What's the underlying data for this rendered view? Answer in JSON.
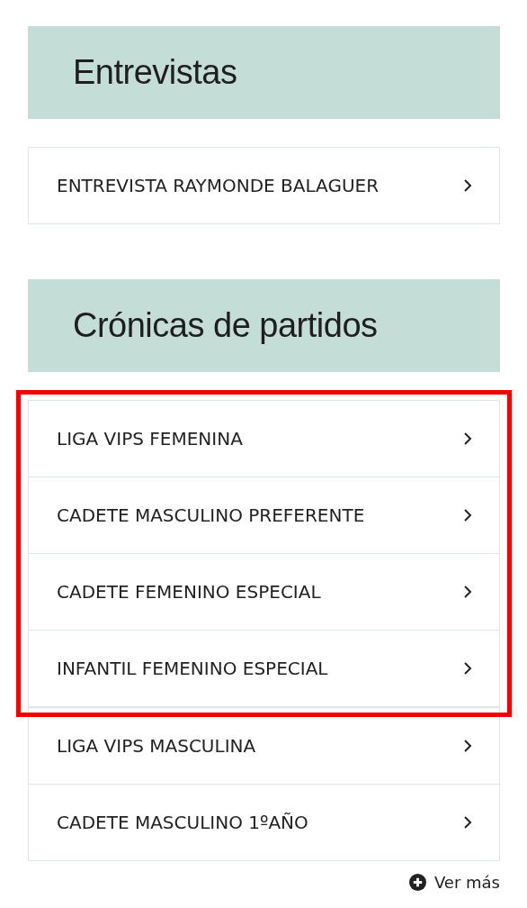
{
  "sections": [
    {
      "title": "Entrevistas",
      "groups": [
        {
          "highlighted": false,
          "items": [
            "ENTREVISTA RAYMONDE BALAGUER"
          ]
        }
      ]
    },
    {
      "title": "Crónicas de partidos",
      "groups": [
        {
          "highlighted": true,
          "items": [
            "LIGA VIPS FEMENINA",
            "CADETE MASCULINO PREFERENTE",
            "CADETE FEMENINO ESPECIAL",
            "INFANTIL FEMENINO ESPECIAL"
          ]
        },
        {
          "highlighted": false,
          "items": [
            "LIGA VIPS MASCULINA",
            "CADETE MASCULINO 1ºAÑO"
          ]
        }
      ],
      "more": "Ver más"
    }
  ]
}
